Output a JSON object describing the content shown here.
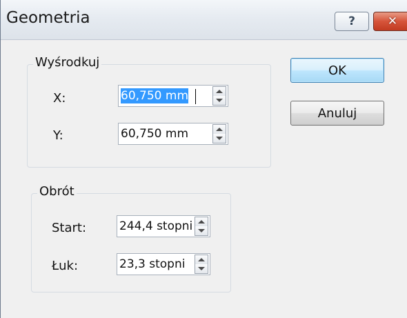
{
  "window": {
    "title": "Geometria",
    "help_glyph": "?",
    "close_glyph": "✕"
  },
  "center_group": {
    "title": "Wyśrodkuj",
    "x_label": "X:",
    "x_value": "60,750 mm",
    "y_label": "Y:",
    "y_value": "60,750 mm"
  },
  "rotation_group": {
    "title": "Obrót",
    "start_label": "Start:",
    "start_value": "244,4 stopni",
    "arc_label": "Łuk:",
    "arc_value": "23,3 stopni"
  },
  "buttons": {
    "ok_label": "OK",
    "cancel_label": "Anuluj"
  },
  "colors": {
    "selection": "#3399ff",
    "default_button": "#a7d9f5",
    "close_button": "#c23c22"
  }
}
